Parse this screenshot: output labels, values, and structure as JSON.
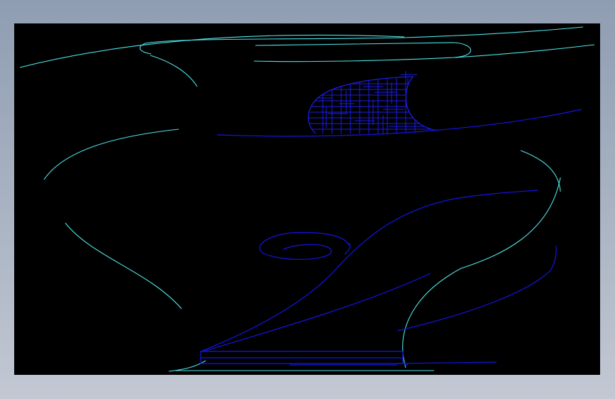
{
  "viewport": {
    "background_frame_color": "#95a2b5",
    "canvas_color": "#000000"
  },
  "drawing": {
    "colors": {
      "cyan_line": "#4fe3e6",
      "blue_line": "#1414e6",
      "hatch": "#1c1ce8"
    },
    "elements": [
      "top-left-cyan-arc",
      "top-right-cyan-swirl",
      "hatched-region",
      "horizontal-blue-curve",
      "left-cyan-bowl",
      "right-cyan-bowl",
      "blue-spiral",
      "blue-sweep-curves",
      "base-plate-rectangle"
    ]
  }
}
